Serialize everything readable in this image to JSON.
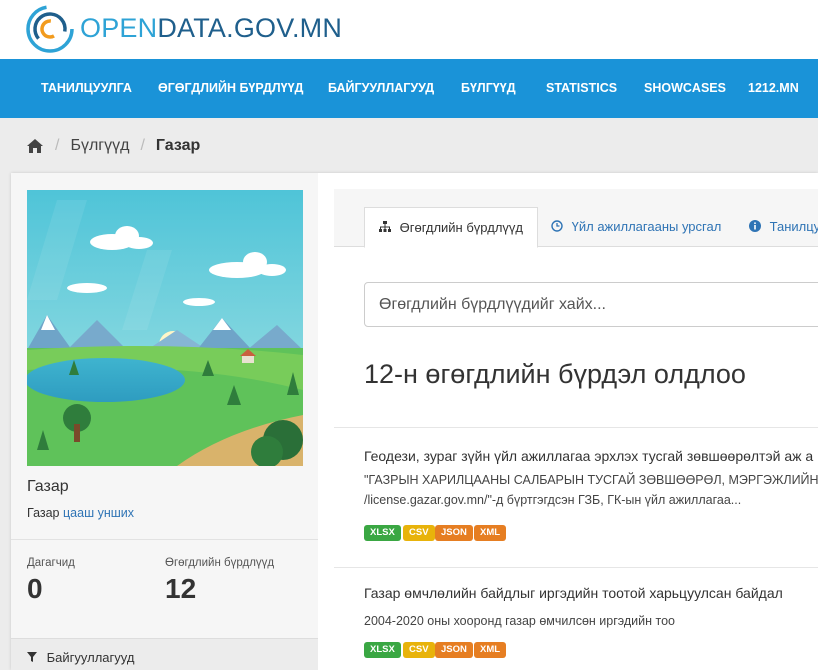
{
  "logo": {
    "prefix": "OPEN",
    "suffix": "DATA.GOV.MN"
  },
  "nav": [
    "ТАНИЛЦУУЛГА",
    "ӨГӨГДЛИЙН БҮРДЛҮҮД",
    "БАЙГУУЛЛАГУУД",
    "БҮЛГҮҮД",
    "STATISTICS",
    "SHOWCASES",
    "1212.MN"
  ],
  "breadcrumb": {
    "groups": "Бүлгүүд",
    "current": "Газар"
  },
  "sidebar": {
    "name": "Газар",
    "desc": "Газар",
    "read_more": "цааш унших",
    "followers_label": "Дагагчид",
    "followers": "0",
    "datasets_label": "Өгөгдлийн бүрдлүүд",
    "datasets": "12",
    "filter_title": "Байгууллагууд"
  },
  "tabs": [
    "Өгөгдлийн бүрдлүүд",
    "Үйл ажиллагааны урсгал",
    "Танилцу"
  ],
  "search": {
    "placeholder": "Өгөгдлийн бүрдлүүдийг хайх..."
  },
  "result_count": "12-н өгөгдлийн бүрдэл олдлоо",
  "datasets": [
    {
      "title": "Геодези, зураг зүйн үйл ажиллагаа эрхлэх тусгай зөвшөөрөлтэй аж а",
      "note_1": "\"ГАЗРЫН ХАРИЛЦААНЫ САЛБАРЫН ТУСГАЙ ЗӨВШӨӨРӨЛ, МЭРГЭЖЛИЙН БАЙ",
      "note_2": "/license.gazar.gov.mn/\"-д бүртгэгдсэн ГЗБ, ГК-ын үйл ажиллагаа...",
      "formats": [
        "XLSX",
        "CSV",
        "JSON",
        "XML"
      ]
    },
    {
      "title": "Газар өмчлөлийн байдлыг иргэдийн тоотой харьцуулсан байдал",
      "note_1": "2004-2020 оны хооронд газар өмчилсөн иргэдийн тоо",
      "formats": [
        "XLSX",
        "CSV",
        "JSON",
        "XML"
      ]
    }
  ],
  "colors": {
    "nav": "#1a93d8",
    "xlsx": "#3aa743",
    "csv": "#e8b30b",
    "json": "#e67e22",
    "xml": "#e67e22"
  }
}
